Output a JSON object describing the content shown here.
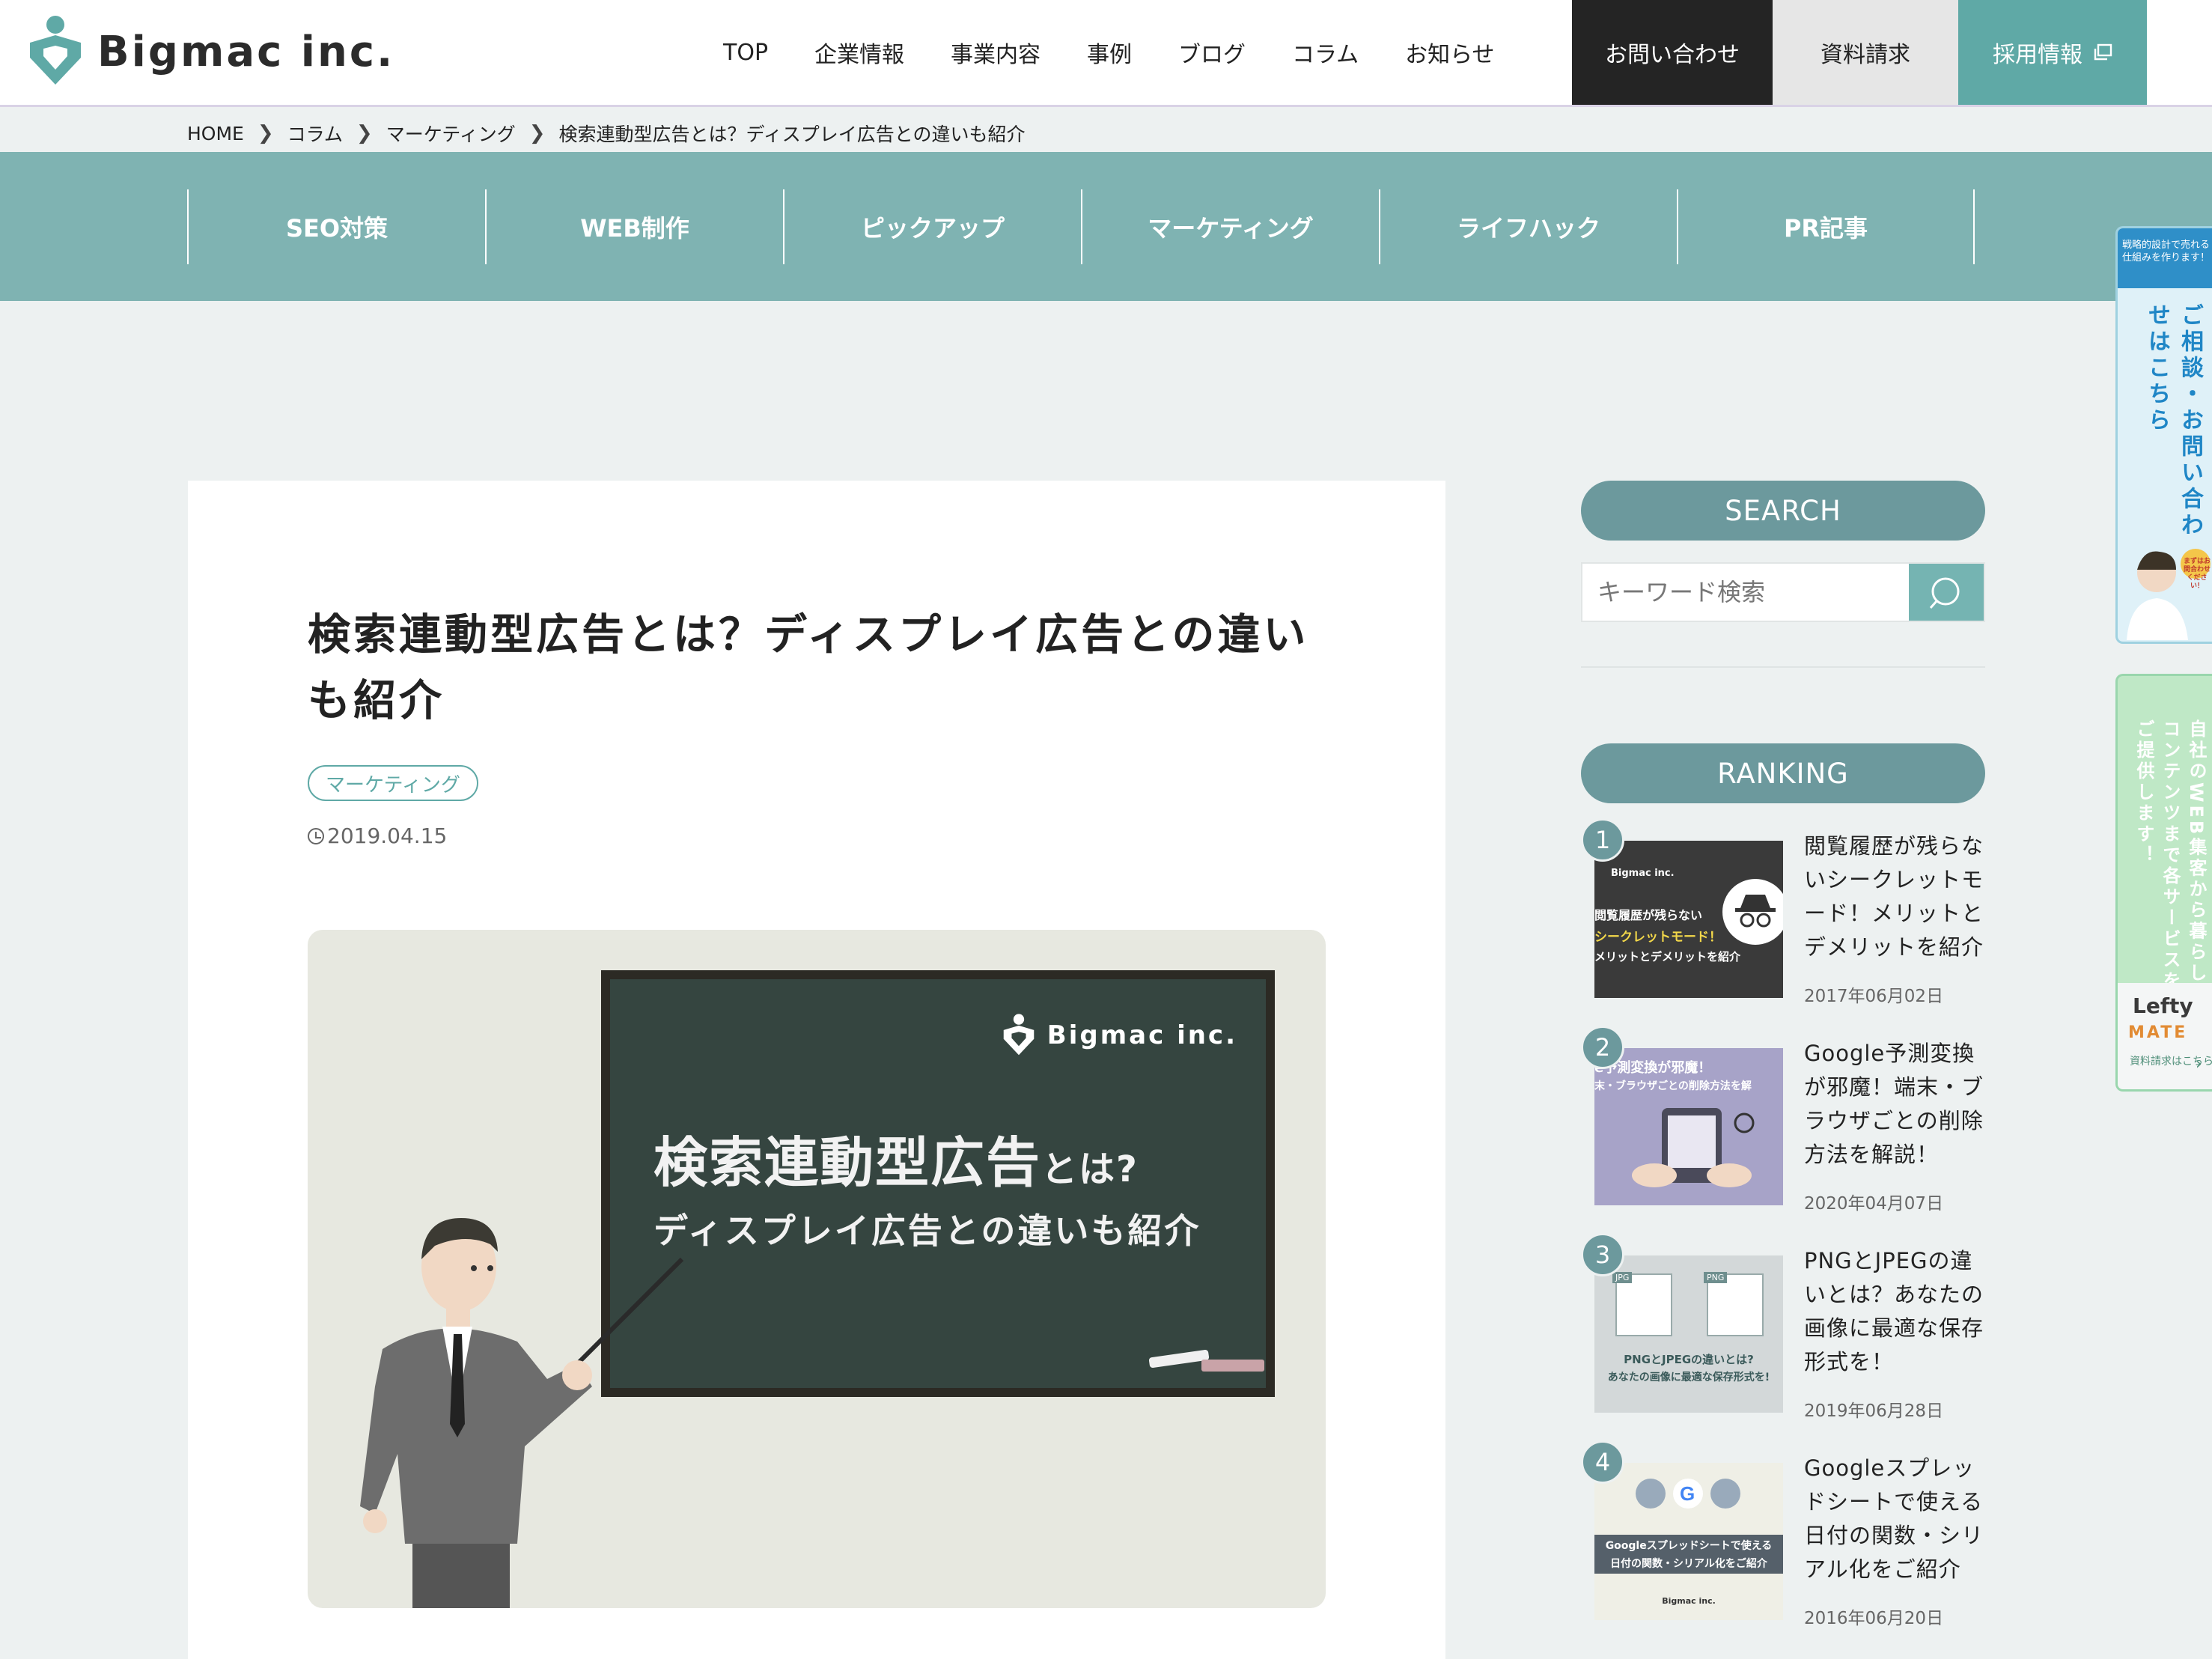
{
  "header": {
    "logo_text": "Bigmac inc.",
    "nav": [
      "TOP",
      "企業情報",
      "事業内容",
      "事例",
      "ブログ",
      "コラム",
      "お知らせ"
    ],
    "contact_label": "お問い合わせ",
    "docs_label": "資料請求",
    "recruit_label": "採用情報"
  },
  "breadcrumb": [
    "HOME",
    "コラム",
    "マーケティング",
    "検索連動型広告とは？ディスプレイ広告との違いも紹介"
  ],
  "categories": [
    "SEO対策",
    "WEB制作",
    "ピックアップ",
    "マーケティング",
    "ライフハック",
    "PR記事"
  ],
  "article": {
    "title_line1": "検索連動型広告とは？ディスプレイ広告との違い",
    "title_line2": "も紹介",
    "tag": "マーケティング",
    "date": "2019.04.15",
    "hero": {
      "logo": "Bigmac inc.",
      "line1": "検索連動型広告",
      "line1_small": "とは?",
      "line2": "ディスプレイ広告との違いも紹介"
    }
  },
  "sidebar": {
    "search_heading": "SEARCH",
    "search_placeholder": "キーワード検索",
    "ranking_heading": "RANKING",
    "ranking": [
      {
        "rank": "1",
        "title": "閲覧履歴が残らないシークレットモード！メリットとデメリットを紹介",
        "date": "2017年06月02日",
        "thumb_logo": "Bigmac inc.",
        "thumb_l1": "閲覧履歴が残らない",
        "thumb_l2": "シークレットモード！",
        "thumb_l3": "メリットとデメリットを紹介"
      },
      {
        "rank": "2",
        "title": "Google予測変換が邪魔！端末・ブラウザごとの削除方法を解説！",
        "date": "2020年04月07日",
        "thumb_l1": "e予測変換が邪魔！",
        "thumb_l2": "末・ブラウザごとの削除方法を解"
      },
      {
        "rank": "3",
        "title": "PNGとJPEGの違いとは？あなたの画像に最適な保存形式を！",
        "date": "2019年06月28日",
        "thumb_tag1": "JPG",
        "thumb_tag2": "PNG",
        "thumb_l1": "PNGとJPEGの違いとは?",
        "thumb_l2": "あなたの画像に最適な保存形式を!"
      },
      {
        "rank": "4",
        "title": "Googleスプレッドシートで使える日付の関数・シリアル化をご紹介",
        "date": "2016年06月20日",
        "thumb_l1": "Googleスプレッドシートで使える",
        "thumb_l2": "日付の関数・シリアル化をご紹介",
        "thumb_logo": "Bigmac inc."
      }
    ]
  },
  "floating": {
    "banner1_top": "戦略的設計で売れる仕組みを作ります！",
    "banner1_text": "ご相談・お問い合わせはこちら",
    "banner1_badge": "まずはお問合わせください！",
    "banner2_text": "自社のWEB集客から暮らしのコンテンツまで各サービスをご提供します！",
    "banner2_brand1": "Lefty",
    "banner2_brand2": "MATE",
    "banner2_req": "資料請求はこちら"
  },
  "colors": {
    "teal": "#7fb3b2",
    "teal_dark": "#6c999d",
    "accent": "#5fa9a6",
    "contact_bg": "#242424"
  }
}
